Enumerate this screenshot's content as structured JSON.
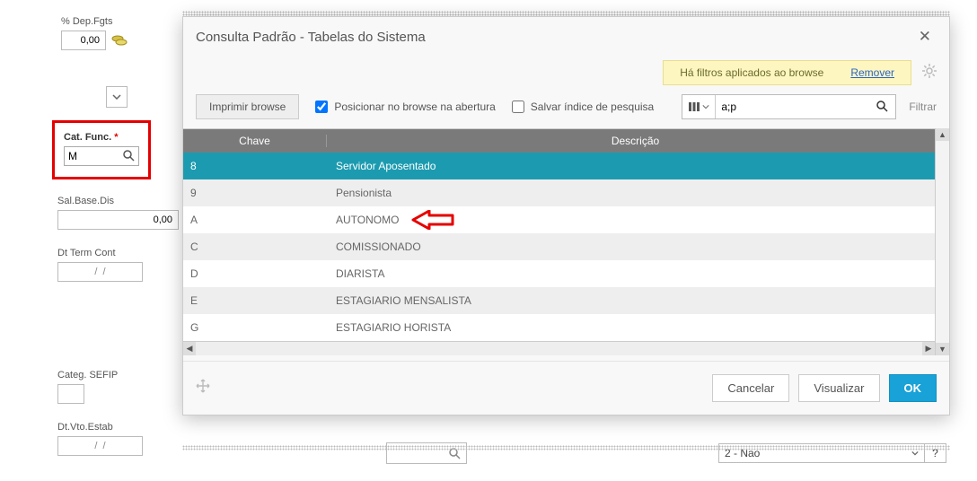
{
  "bg": {
    "dep_fgts_label": "% Dep.Fgts",
    "dep_fgts_value": "0,00",
    "cat_func_label": "Cat. Func.",
    "cat_func_value": "M",
    "sal_base_label": "Sal.Base.Dis",
    "sal_base_value": "0,00",
    "dt_term_label": "Dt Term Cont",
    "dt_term_value": "/  /",
    "categ_sefip_label": "Categ. SEFIP",
    "categ_sefip_value": "",
    "dt_vto_label": "Dt.Vto.Estab",
    "dt_vto_value": "/  /",
    "bottom_select_value": "2 - Nao"
  },
  "modal": {
    "title": "Consulta Padrão - Tabelas do Sistema",
    "filter_banner": "Há filtros aplicados ao browse",
    "filter_remove": "Remover",
    "btn_print": "Imprimir browse",
    "chk_position": "Posicionar no browse na abertura",
    "chk_saveindex": "Salvar índice de pesquisa",
    "search_value": "a;p",
    "filtrar": "Filtrar",
    "col_chave": "Chave",
    "col_desc": "Descrição",
    "rows": [
      {
        "chave": "8",
        "desc": "Servidor Aposentado"
      },
      {
        "chave": "9",
        "desc": "Pensionista"
      },
      {
        "chave": "A",
        "desc": "AUTONOMO"
      },
      {
        "chave": "C",
        "desc": "COMISSIONADO"
      },
      {
        "chave": "D",
        "desc": "DIARISTA"
      },
      {
        "chave": "E",
        "desc": "ESTAGIARIO MENSALISTA"
      },
      {
        "chave": "G",
        "desc": "ESTAGIARIO HORISTA"
      }
    ],
    "btn_cancel": "Cancelar",
    "btn_view": "Visualizar",
    "btn_ok": "OK"
  }
}
